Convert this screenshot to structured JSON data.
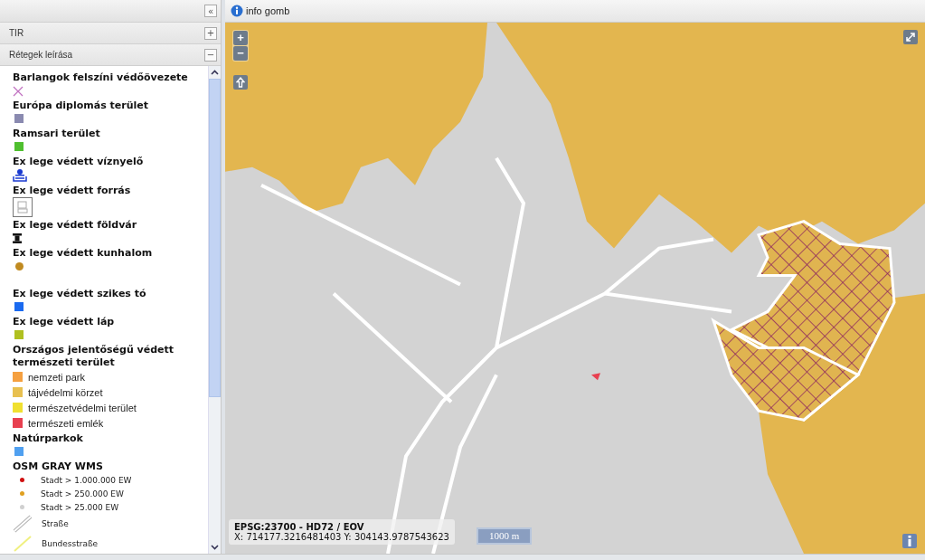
{
  "left_panel": {
    "collapse_button": "«",
    "sections": [
      {
        "title": "TIR",
        "toggle": "+"
      },
      {
        "title": "Rétegek leírása",
        "toggle": "−"
      }
    ]
  },
  "legend": [
    {
      "title": "Barlangok felszíni védőövezete",
      "symbols": [
        {
          "kind": "cross",
          "color": "#c070c0"
        }
      ]
    },
    {
      "title": "Európa diplomás terület",
      "symbols": [
        {
          "kind": "square",
          "color": "#8a8ab0"
        }
      ]
    },
    {
      "title": "Ramsari terület",
      "symbols": [
        {
          "kind": "square",
          "color": "#4fbf2f"
        }
      ]
    },
    {
      "title": "Ex lege védett víznyelő",
      "symbols": [
        {
          "kind": "sinkhole"
        }
      ]
    },
    {
      "title": "Ex lege védett forrás",
      "symbols": [
        {
          "kind": "image"
        }
      ]
    },
    {
      "title": "Ex lege védett földvár",
      "symbols": [
        {
          "kind": "fort"
        }
      ]
    },
    {
      "title": "Ex lege védett kunhalom",
      "symbols": [
        {
          "kind": "dot",
          "color": "#c08a20"
        }
      ]
    },
    {
      "title": "Ex lege védett szikes tó",
      "symbols": [
        {
          "kind": "square",
          "color": "#1a6af0"
        }
      ]
    },
    {
      "title": "Ex lege védett láp",
      "symbols": [
        {
          "kind": "square",
          "color": "#b0c020"
        }
      ]
    },
    {
      "title": "Országos jelentőségű védett természeti terület",
      "symbols": [
        {
          "kind": "swatch",
          "color": "#f5a040",
          "label": "nemzeti park"
        },
        {
          "kind": "swatch",
          "color": "#e8c050",
          "label": "tájvédelmi körzet"
        },
        {
          "kind": "swatch",
          "color": "#f0e030",
          "label": "természetvédelmi terület"
        },
        {
          "kind": "swatch",
          "color": "#e84050",
          "label": "természeti emlék"
        }
      ]
    },
    {
      "title": "Natúrparkok",
      "symbols": [
        {
          "kind": "square",
          "color": "#50a0f0"
        }
      ]
    },
    {
      "title": "OSM GRAY WMS",
      "symbols": [
        {
          "kind": "point",
          "color": "#d01010",
          "label": "Stadt > 1.000.000 EW"
        },
        {
          "kind": "point",
          "color": "#e0a020",
          "label": "Stadt > 250.000 EW"
        },
        {
          "kind": "point",
          "color": "#d0d0d0",
          "label": "Stadt > 25.000 EW"
        },
        {
          "kind": "line",
          "color": "#b0b0b0",
          "label": "Straße"
        },
        {
          "kind": "line",
          "color": "#f0f080",
          "label": "Bundesstraße"
        }
      ]
    }
  ],
  "toolbar": {
    "info_button": "info gomb"
  },
  "map": {
    "zoom_in": "+",
    "zoom_out": "−",
    "projection": "EPSG:23700 - HD72 / EOV",
    "coordinates": "X: 714177.3216481403 Y: 304143.9787543623",
    "scale": "1000 m"
  }
}
